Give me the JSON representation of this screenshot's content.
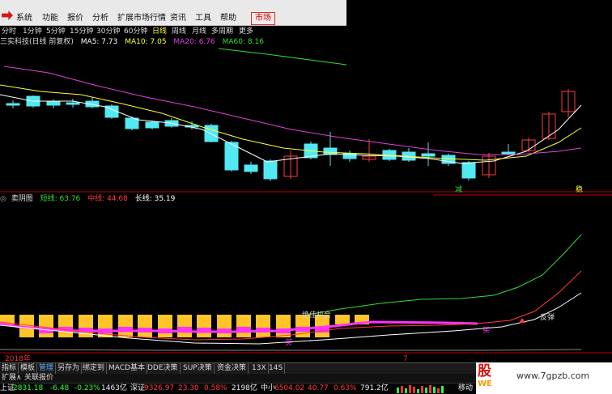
{
  "menu": {
    "items": [
      "系统",
      "功能",
      "报价",
      "分析",
      "扩展市场行情",
      "资讯",
      "工具",
      "帮助"
    ],
    "market": "市场"
  },
  "periods": {
    "items": [
      "分时",
      "1分钟",
      "5分钟",
      "15分钟",
      "30分钟",
      "60分钟",
      "日线",
      "周线",
      "月线",
      "多周期",
      "更多"
    ],
    "active": "日线"
  },
  "legend": {
    "stock": "三实科技(日线 前复权)",
    "ma5": "MA5: 7.73",
    "ma10": "MA10: 7.05",
    "ma20": "MA20: 6.76",
    "ma60": "MA60: 8.16"
  },
  "indicator": {
    "name": "卖阴图",
    "short": "短线: 63.76",
    "mid": "中线: 44.68",
    "long": "长线: 35.19",
    "label_reduce": "减",
    "label_stable": "稳",
    "label_peak": "绝佳机会",
    "label_rebound": "反弹",
    "label_buy": "买"
  },
  "axis": {
    "year": "2018年",
    "month": "7"
  },
  "toolbar": {
    "items": [
      "指标",
      "模板",
      "管理",
      "另存为",
      "绑定到",
      "MACD基本",
      "DDE决策",
      "SUP决策",
      "资金决策",
      "13X",
      "14S"
    ],
    "active": "管理"
  },
  "subbar": {
    "items": [
      "扩展∧",
      "关联报价"
    ]
  },
  "status": {
    "sh_label": "上证",
    "sh_value": "2831.18",
    "sh_change": "-6.48",
    "sh_pct": "-0.23%",
    "sh_amount": "1463亿",
    "sz_label": "深证",
    "sz_value": "9326.97",
    "sz_change": "23.30",
    "sz_pct": "0.58%",
    "sz_amount": "2198亿",
    "zx_label": "中小",
    "zx_value": "6504.02",
    "zx_change": "40.77",
    "zx_pct": "0.63%",
    "zx_amount": "791.2亿",
    "mobile": "移动"
  },
  "watermark": {
    "badge": "股",
    "badge2": "WE",
    "url": "www.7gpzb.com"
  },
  "colors": {
    "up": "#ff3b3b",
    "down": "#53e9f3",
    "ma5": "#ffffff",
    "ma10": "#ffff33",
    "ma20": "#e040e0",
    "ma60": "#33dd33",
    "bar_yellow": "#ffc428",
    "bar_magenta": "#ff33ff"
  },
  "icons": {
    "logo": "app-logo-icon",
    "circle": "collapse-circle-icon"
  }
}
